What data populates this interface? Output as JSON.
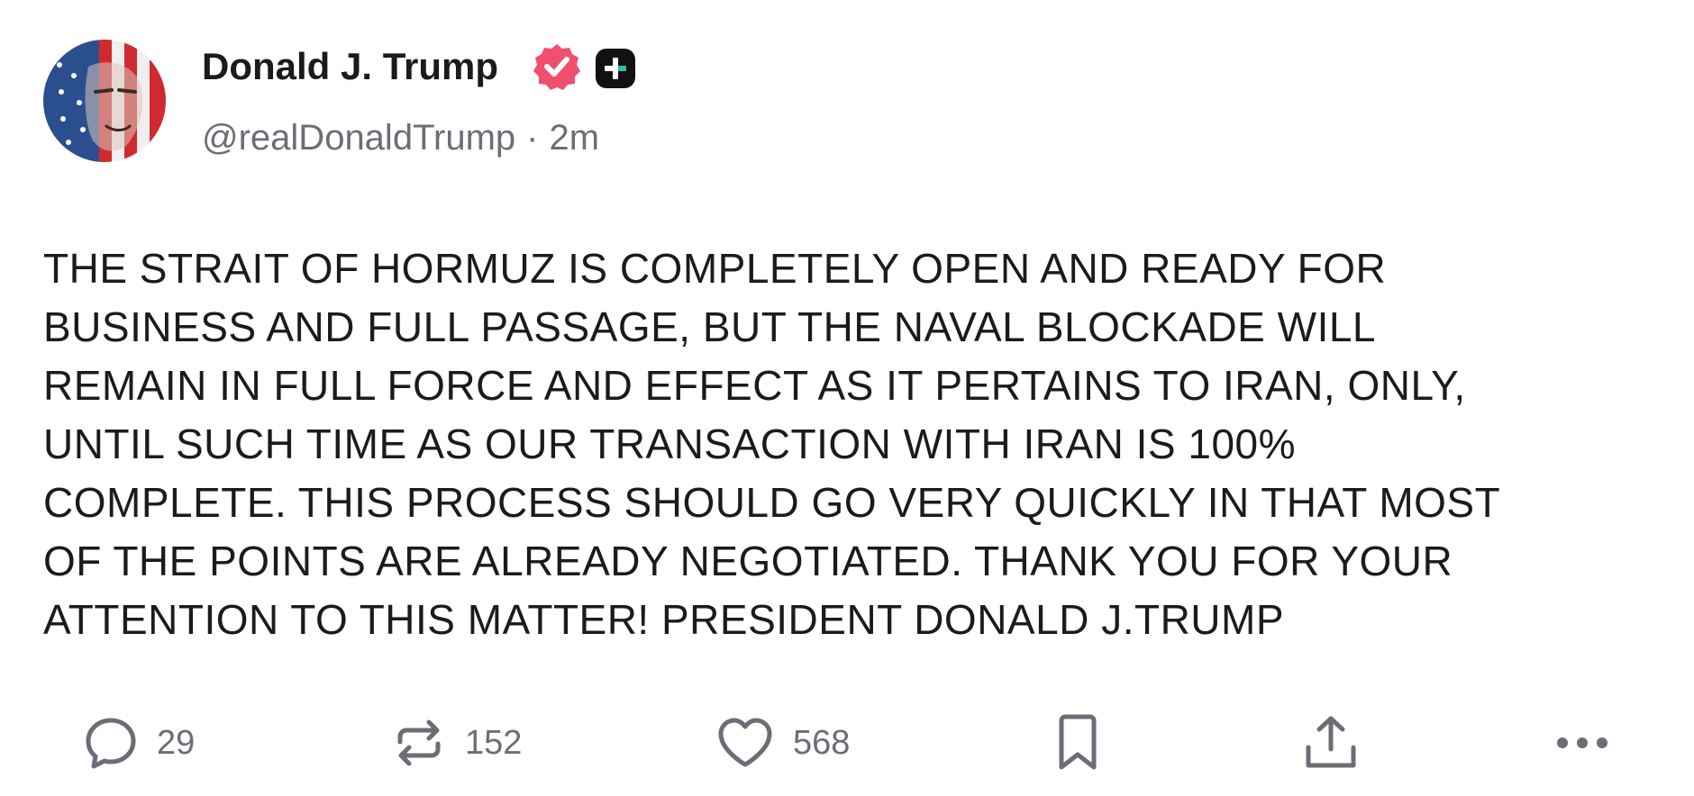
{
  "author": {
    "display_name": "Donald J. Trump",
    "handle": "@realDonaldTrump",
    "separator": "·",
    "time_ago": "2m",
    "verified_icon": "verified-badge-icon",
    "plus_badge_icon": "plus-badge-icon"
  },
  "post": {
    "text": "THE STRAIT OF HORMUZ IS COMPLETELY OPEN AND READY FOR\nBUSINESS AND FULL PASSAGE, BUT THE NAVAL BLOCKADE WILL\nREMAIN IN FULL FORCE AND EFFECT AS IT PERTAINS TO IRAN, ONLY,\nUNTIL SUCH TIME AS OUR TRANSACTION WITH IRAN IS 100%\nCOMPLETE. THIS PROCESS SHOULD GO VERY QUICKLY IN THAT MOST\nOF THE POINTS ARE ALREADY NEGOTIATED. THANK YOU FOR YOUR\nATTENTION TO THIS MATTER! PRESIDENT DONALD J.TRUMP"
  },
  "actions": {
    "reply_count": "29",
    "repost_count": "152",
    "like_count": "568",
    "icons": [
      "reply-icon",
      "repost-icon",
      "heart-icon",
      "bookmark-icon",
      "share-icon",
      "more-icon"
    ]
  },
  "colors": {
    "text": "#1b1b1f",
    "muted": "#6b6e76",
    "verified": "#f0506e",
    "plus_badge": "#111111"
  }
}
